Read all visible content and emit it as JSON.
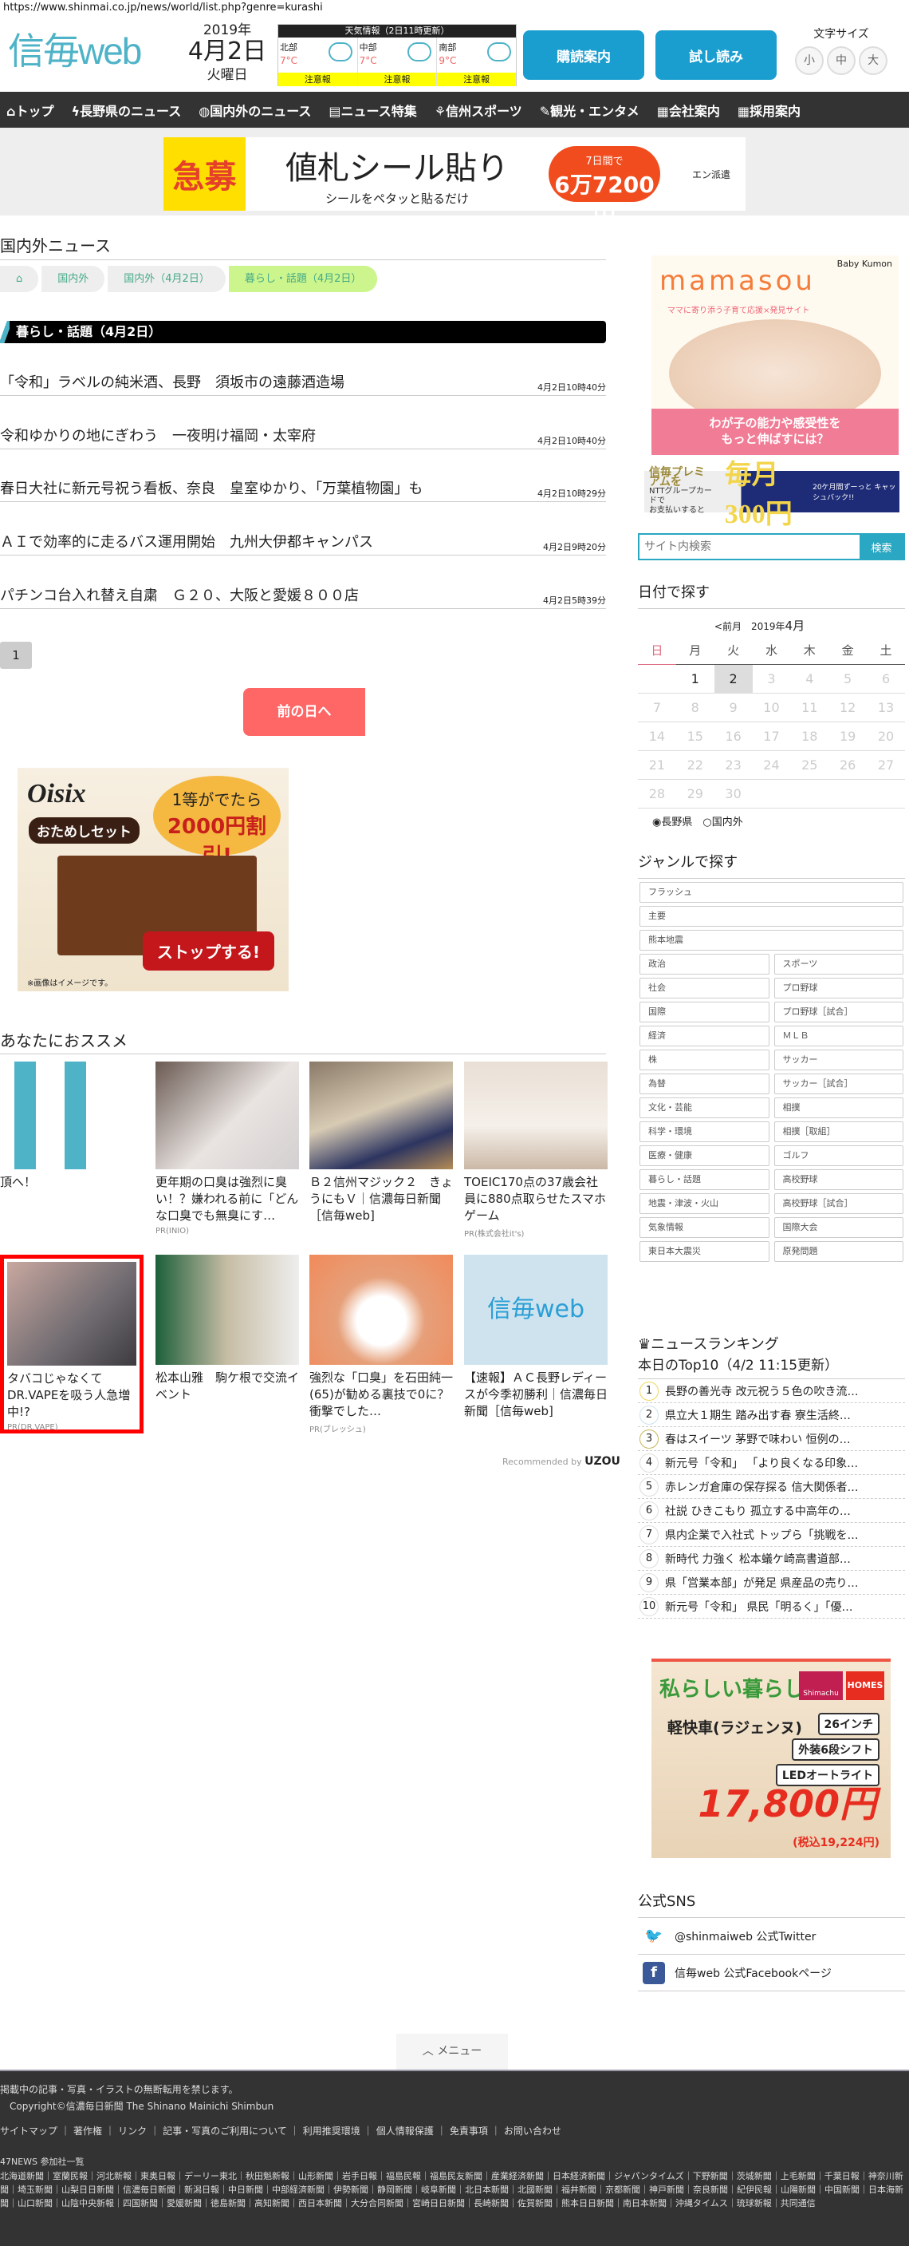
{
  "url": "https://www.shinmai.co.jp/news/world/list.php?genre=kurashi",
  "header": {
    "logo": "信毎web",
    "year": "2019年",
    "date": "4月2日",
    "weekday": "火曜日",
    "weather": {
      "title": "天気情報（2日11時更新）",
      "areas": [
        {
          "name": "北部",
          "temp": "7°C",
          "warning": "注意報",
          "icon": "snow-cloud-icon"
        },
        {
          "name": "中部",
          "temp": "7°C",
          "warning": "注意報",
          "icon": "sun-cloud-icon"
        },
        {
          "name": "南部",
          "temp": "9°C",
          "warning": "注意報",
          "icon": "sun-cloud-icon"
        }
      ]
    },
    "subscribe": "購読案内",
    "trial": "試し読み",
    "font_size_label": "文字サイズ",
    "font_sizes": [
      "小",
      "中",
      "大"
    ]
  },
  "nav": [
    "トップ",
    "長野県のニュース",
    "国内外のニュース",
    "ニュース特集",
    "信州スポーツ",
    "観光・エンタメ",
    "会社案内",
    "採用案内"
  ],
  "top_ad": {
    "badge": "急募",
    "headline": "値札シール貼り",
    "sub": "シールをペタッと貼るだけ",
    "pill_top": "7日間で",
    "pill_price": "6万7200円",
    "brand": "エン派遣"
  },
  "main": {
    "title": "国内外ニュース",
    "breadcrumb": [
      "国内外",
      "国内外（4月2日）",
      "暮らし・話題（4月2日）"
    ],
    "category": "暮らし・話題（4月2日）",
    "news": [
      {
        "title": "「令和」ラベルの純米酒、長野　須坂市の遠藤酒造場",
        "time": "4月2日10時40分"
      },
      {
        "title": "令和ゆかりの地にぎわう　一夜明け福岡・太宰府",
        "time": "4月2日10時40分"
      },
      {
        "title": "春日大社に新元号祝う看板、奈良　皇室ゆかり、「万葉植物園」も",
        "time": "4月2日10時29分"
      },
      {
        "title": "ＡＩで効率的に走るバス運用開始　九州大伊都キャンパス",
        "time": "4月2日9時20分"
      },
      {
        "title": "パチンコ台入れ替え自粛　Ｇ２０、大阪と愛媛８００店",
        "time": "4月2日5時39分"
      }
    ],
    "page": "1",
    "prev_day": "前の日へ"
  },
  "oisix_ad": {
    "brand": "Oisix",
    "set": "おためしセット",
    "line1": "1等がでたら",
    "line2": "2000円割引!",
    "cta": "ストップする!",
    "note": "※画像はイメージです。"
  },
  "recommend": {
    "title": "あなたにおススメ",
    "cards": [
      {
        "title": "頂へ！",
        "pr": ""
      },
      {
        "title": "更年期の口臭は強烈に臭い！？嫌われる前に「どんな口臭でも無臭にす…",
        "pr": "PR(INIO)"
      },
      {
        "title": "Ｂ２信州マジック２　きょうにもＶ｜信濃毎日新聞［信毎web]",
        "pr": ""
      },
      {
        "title": "TOEIC170点の37歳会社員に880点取らせたスマホゲーム",
        "pr": "PR(株式会社it's)"
      },
      {
        "title": "タバコじゃなくてDR.VAPEを吸う人急増中!?",
        "pr": "PR(DR.VAPE)"
      },
      {
        "title": "松本山雅　駒ケ根で交流イベント",
        "pr": ""
      },
      {
        "title": "強烈な「口臭」を石田純一(65)が勧める裏技で0に？衝撃でした…",
        "pr": "PR(ブレッシュ)"
      },
      {
        "title": "【速報】ＡＣ長野レディースが今季初勝利｜信濃毎日新聞［信毎web]",
        "pr": ""
      }
    ],
    "recommended_by": "Recommended by",
    "uzou": "UZOU"
  },
  "sidebar": {
    "mamasou": {
      "logo": "mamasou",
      "tagline": "ママに寄り添う子育て応援×発見サイト",
      "brand": "Baby Kumon",
      "cta1": "わが子の能力や感受性を",
      "cta2": "もっと伸ばすには？"
    },
    "premium": {
      "title": "信毎プレミアムを",
      "text1": "NTTグループカードで",
      "text2": "お支払いすると",
      "big": "毎月300円",
      "side": "20ケ月間ずーっと キャッシュバック!!"
    },
    "search": {
      "placeholder": "サイト内検索",
      "button": "検索"
    },
    "calendar": {
      "title": "日付で探す",
      "prev": "<前月",
      "month_prefix": "2019年",
      "month": "4月",
      "weekdays": [
        "日",
        "月",
        "火",
        "水",
        "木",
        "金",
        "土"
      ],
      "weeks": [
        [
          "",
          "1",
          "2",
          "3",
          "4",
          "5",
          "6"
        ],
        [
          "7",
          "8",
          "9",
          "10",
          "11",
          "12",
          "13"
        ],
        [
          "14",
          "15",
          "16",
          "17",
          "18",
          "19",
          "20"
        ],
        [
          "21",
          "22",
          "23",
          "24",
          "25",
          "26",
          "27"
        ],
        [
          "28",
          "29",
          "30",
          "",
          "",
          "",
          ""
        ]
      ],
      "selected": "2",
      "regions": [
        "長野県",
        "国内外"
      ]
    },
    "genre": {
      "title": "ジャンルで探す",
      "full": [
        "フラッシュ",
        "主要",
        "熊本地震"
      ],
      "pairs": [
        "政治",
        "スポーツ",
        "社会",
        "プロ野球",
        "国際",
        "プロ野球［試合］",
        "経済",
        "ＭＬＢ",
        "株",
        "サッカー",
        "為替",
        "サッカー［試合］",
        "文化・芸能",
        "相撲",
        "科学・環境",
        "相撲［取組］",
        "医療・健康",
        "ゴルフ",
        "暮らし・話題",
        "高校野球",
        "地震・津波・火山",
        "高校野球［試合］",
        "気象情報",
        "国際大会",
        "東日本大震災",
        "原発問題"
      ]
    },
    "ranking": {
      "title": "ニュースランキング",
      "subtitle": "本日のTop10（4/2 11:15更新）",
      "items": [
        "長野の善光寺 改元祝う５色の吹き流…",
        "県立大１期生 踏み出す春 寮生活終…",
        "春はスイーツ 茅野で味わい 恒例の…",
        "新元号「令和」 「より良くなる印象…",
        "赤レンガ倉庫の保存探る 信大関係者…",
        "社説 ひきこもり 孤立する中高年の…",
        "県内企業で入社式 トップら「挑戦を…",
        "新時代 力強く 松本蟻ケ崎高書道部…",
        "県「営業本部」が発足 県産品の売り…",
        "新元号「令和」 県民「明るく」「優…"
      ]
    },
    "homes_ad": {
      "headline": "私らしい暮らし♪",
      "brand1": "Shimachu",
      "brand2": "HOMES",
      "product": "軽快車(ラジェンヌ)",
      "specs": [
        "26インチ",
        "外装6段シフト",
        "LEDオートライト"
      ],
      "price": "17,800円",
      "tax": "(税込19,224円)"
    },
    "sns": {
      "title": "公式SNS",
      "twitter": "@shinmaiweb 公式Twitter",
      "facebook": "信毎web 公式Facebookページ"
    }
  },
  "menu": "メニュー",
  "footer": {
    "notice": "掲載中の記事・写真・イラストの無断転用を禁じます。",
    "copyright": "Copyright©信濃毎日新聞 The Shinano Mainichi Shimbun",
    "links": [
      "サイトマップ",
      "著作権",
      "リンク",
      "記事・写真のご利用について",
      "利用推奨環境",
      "個人情報保護",
      "免責事項",
      "お問い合わせ"
    ],
    "partners_title": "47NEWS 参加社一覧",
    "partners": "北海道新聞｜室蘭民報｜河北新報｜東奥日報｜デーリー東北｜秋田魁新報｜山形新聞｜岩手日報｜福島民報｜福島民友新聞｜産業経済新聞｜日本経済新聞｜ジャパンタイムズ｜下野新聞｜茨城新聞｜上毛新聞｜千葉日報｜神奈川新聞｜埼玉新聞｜山梨日日新聞｜信濃毎日新聞｜新潟日報｜中日新聞｜中部経済新聞｜伊勢新聞｜静岡新聞｜岐阜新聞｜北日本新聞｜北國新聞｜福井新聞｜京都新聞｜神戸新聞｜奈良新聞｜紀伊民報｜山陽新聞｜中国新聞｜日本海新聞｜山口新聞｜山陰中央新報｜四国新聞｜愛媛新聞｜徳島新聞｜高知新聞｜西日本新聞｜大分合同新聞｜宮崎日日新聞｜長崎新聞｜佐賀新聞｜熊本日日新聞｜南日本新聞｜沖縄タイムス｜琉球新報｜共同通信"
  }
}
